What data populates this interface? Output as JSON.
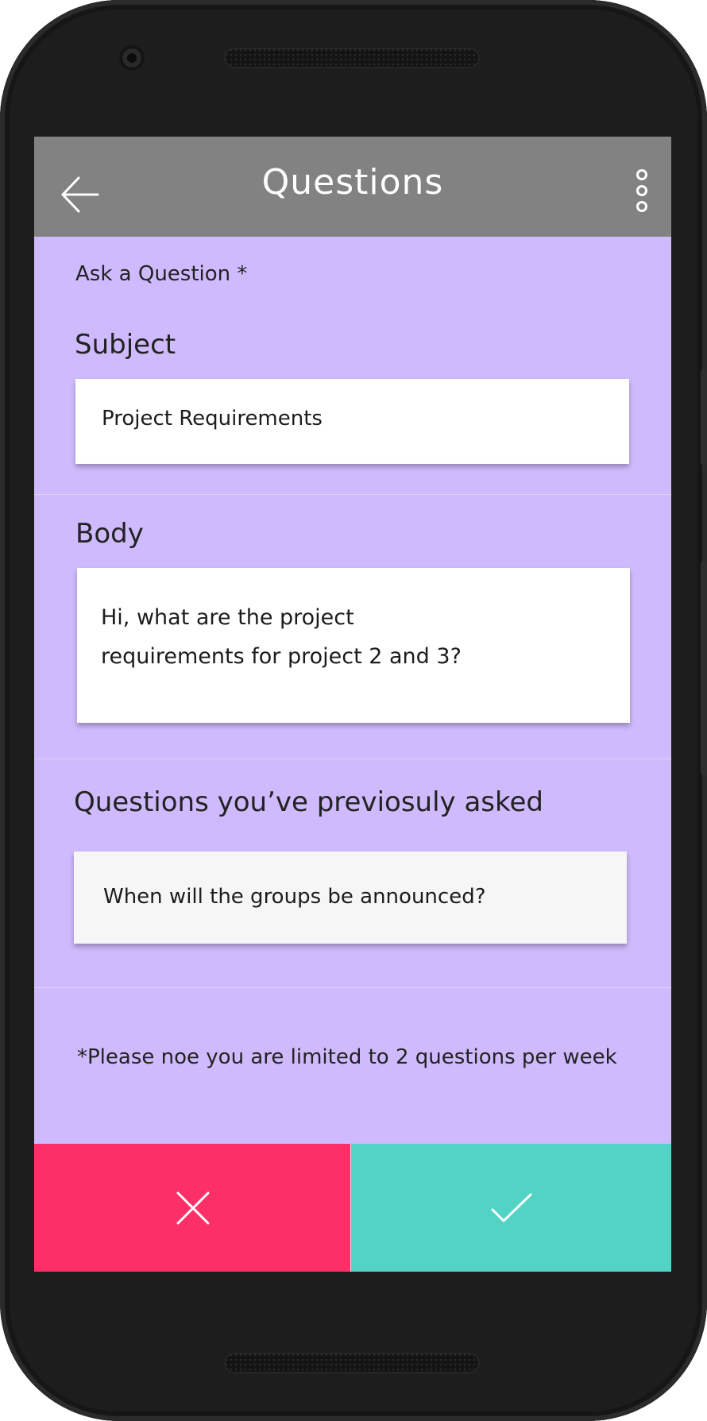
{
  "header": {
    "title": "Questions",
    "back_icon": "arrow-left-icon",
    "menu_icon": "more-vertical-icon"
  },
  "form": {
    "ask_label": "Ask a Question *",
    "subject_label": "Subject",
    "subject_value": "Project Requirements",
    "body_label": "Body",
    "body_value": "Hi, what are the project requirements for project 2 and 3?"
  },
  "previous": {
    "label": "Questions you’ve previosuly asked",
    "items": [
      {
        "text": "When will the groups be announced?"
      }
    ]
  },
  "note": "*Please noe you are limited to 2 questions per week",
  "actions": {
    "cancel_icon": "close-icon",
    "confirm_icon": "check-icon"
  },
  "colors": {
    "appbar": "#828282",
    "background": "#cfbafd",
    "cancel": "#fd2f68",
    "confirm": "#52d3c6"
  }
}
